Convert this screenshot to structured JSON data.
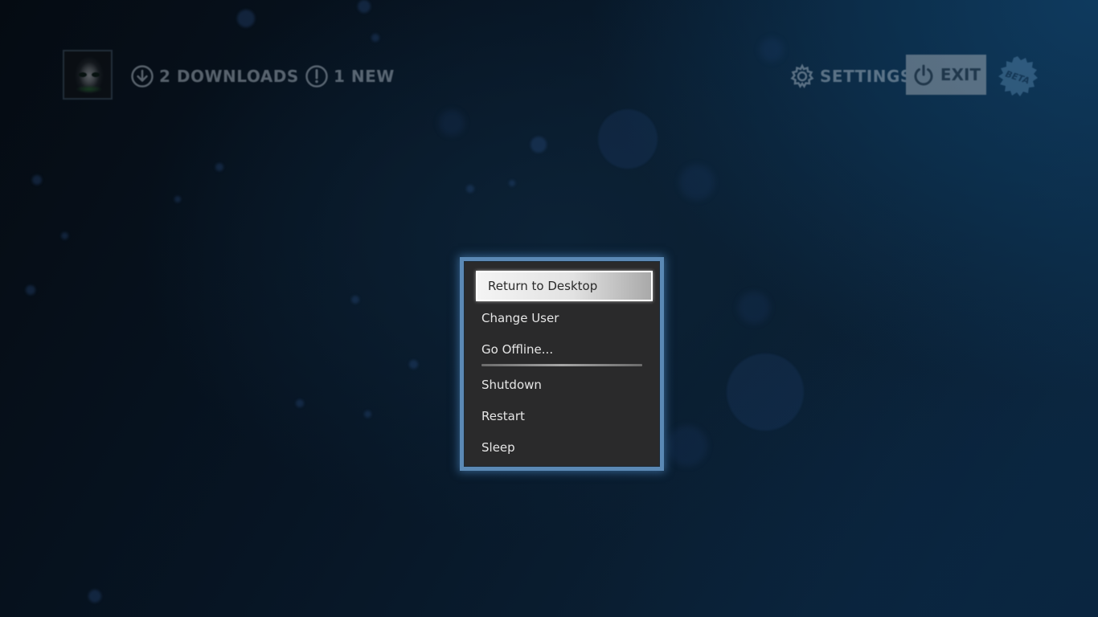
{
  "topbar": {
    "avatar_label": "avatar",
    "downloads_label": "2 DOWNLOADS",
    "news_label": "1 NEW",
    "settings_label": "SETTINGS",
    "exit_label": "EXIT",
    "beta_label": "BETA"
  },
  "power_menu": {
    "items": [
      {
        "label": "Return to Desktop",
        "selected": true
      },
      {
        "label": "Change User"
      },
      {
        "label": "Go Offline..."
      },
      {
        "label": "Shutdown"
      },
      {
        "label": "Restart"
      },
      {
        "label": "Sleep"
      }
    ]
  },
  "icons": {
    "downloads": "download-icon",
    "news": "alert-icon",
    "settings": "gear-icon",
    "exit": "power-icon"
  },
  "colors": {
    "menu_border": "#5b89b5",
    "menu_background": "#2a2a2b",
    "selected_item": "#e2e2e2",
    "text": "#e6e6e6"
  }
}
